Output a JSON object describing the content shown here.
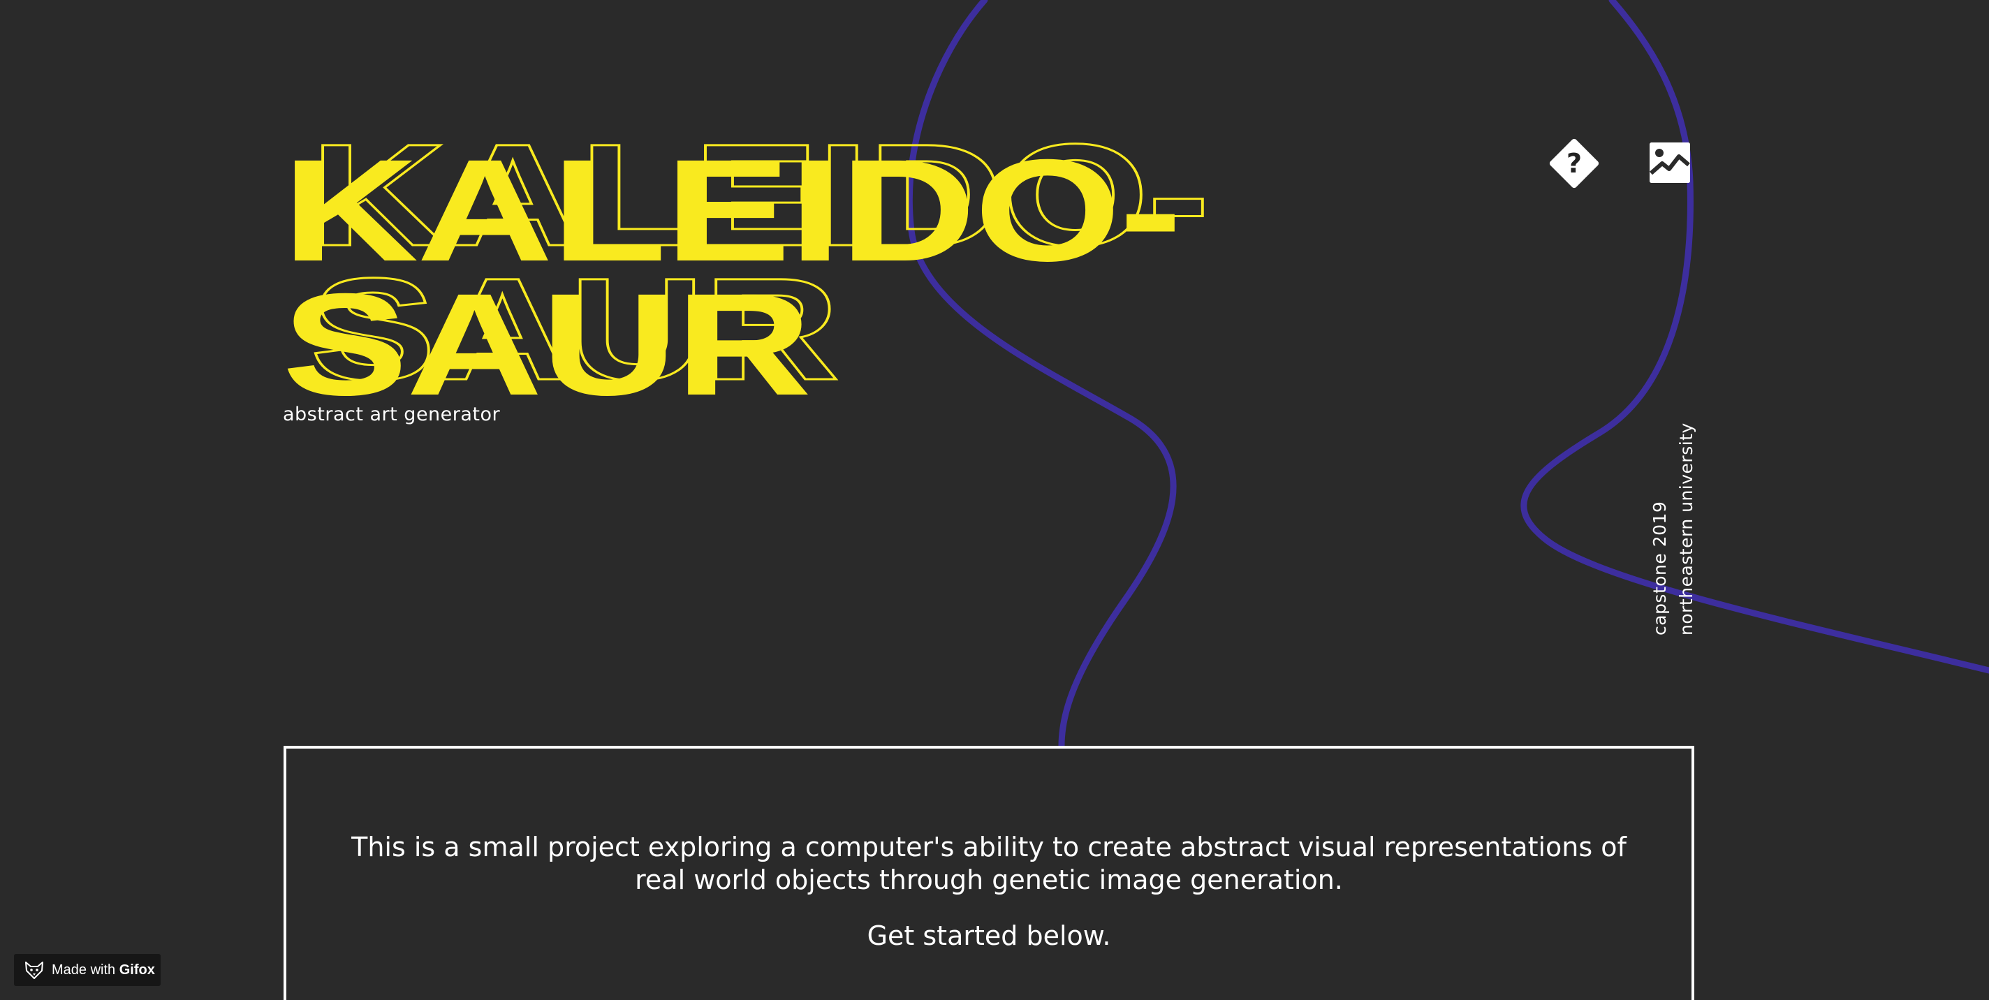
{
  "title": {
    "line1": "KALEIDO-",
    "line2": "SAUR"
  },
  "subtitle": "abstract art generator",
  "header_icons": {
    "help": {
      "glyph": "?",
      "icon": "help-diamond-icon"
    },
    "gallery": {
      "icon": "image-gallery-icon"
    }
  },
  "side_credits": {
    "line1": "capstone 2019",
    "line2": "northeastern university"
  },
  "intro": {
    "text": "This is a small project exploring a computer's ability to create abstract visual representations of real world objects through genetic image generation.",
    "cta": "Get started below."
  },
  "badge": {
    "prefix": "Made with",
    "brand": "Gifox",
    "icon": "fox-icon"
  },
  "colors": {
    "background": "#2a2a2a",
    "title_yellow": "#f9ea1f",
    "squiggle_purple": "#3d2e9e",
    "text_white": "#ffffff"
  }
}
